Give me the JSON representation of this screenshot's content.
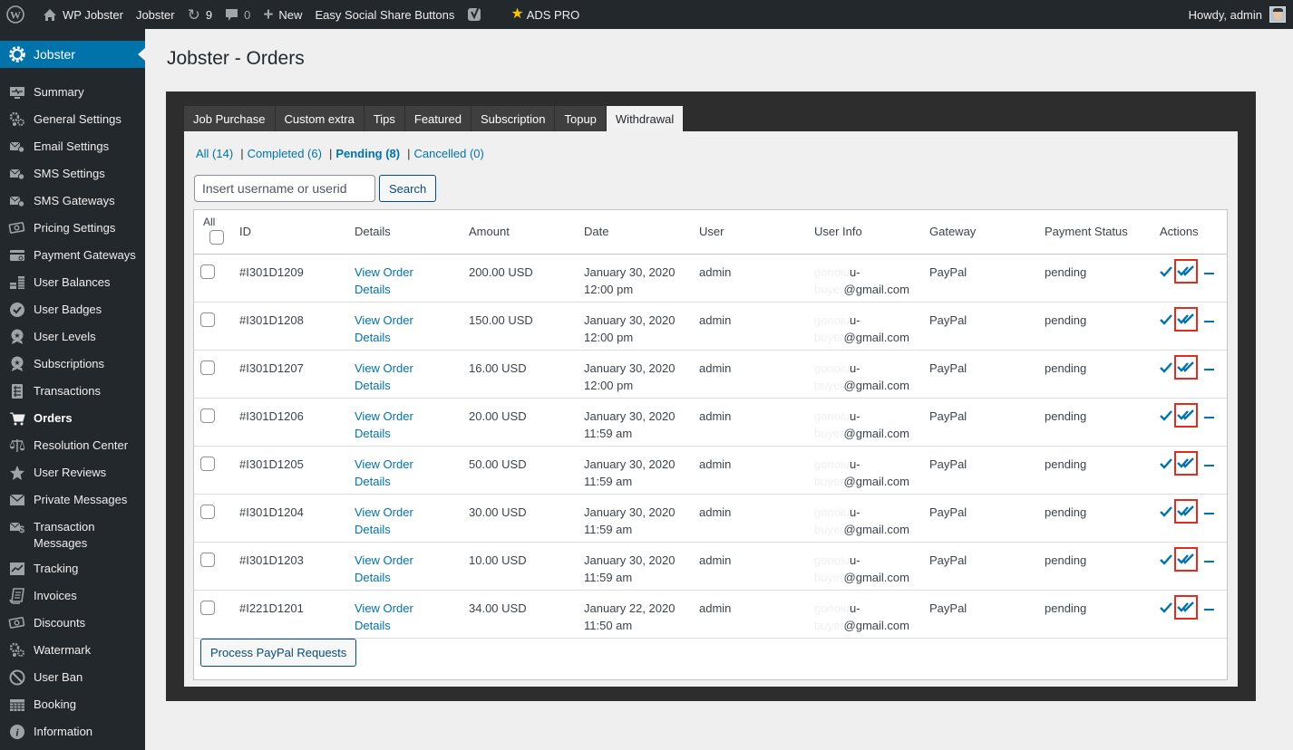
{
  "admin_bar": {
    "site_name": "WP Jobster",
    "plugin_menu": "Jobster",
    "updates_count": "9",
    "comments_count": "0",
    "new_label": "New",
    "essb_label": "Easy Social Share Buttons",
    "ads_label": "ADS PRO",
    "greeting": "Howdy, admin"
  },
  "sidebar": {
    "header": "Jobster",
    "items": [
      {
        "label": "Summary",
        "icon": "pulse-monitor-icon"
      },
      {
        "label": "General Settings",
        "icon": "gears-icon"
      },
      {
        "label": "Email Settings",
        "icon": "mail-gear-icon"
      },
      {
        "label": "SMS Settings",
        "icon": "mail-gear-icon"
      },
      {
        "label": "SMS Gateways",
        "icon": "mail-gear-icon"
      },
      {
        "label": "Pricing Settings",
        "icon": "money-icon"
      },
      {
        "label": "Payment Gateways",
        "icon": "card-icon"
      },
      {
        "label": "User Balances",
        "icon": "coins-icon"
      },
      {
        "label": "User Badges",
        "icon": "badge-check-icon"
      },
      {
        "label": "User Levels",
        "icon": "award-icon"
      },
      {
        "label": "Subscriptions",
        "icon": "award-icon"
      },
      {
        "label": "Transactions",
        "icon": "list-icon"
      },
      {
        "label": "Orders",
        "icon": "cart-icon",
        "active": true
      },
      {
        "label": "Resolution Center",
        "icon": "scales-icon"
      },
      {
        "label": "User Reviews",
        "icon": "star-icon"
      },
      {
        "label": "Private Messages",
        "icon": "envelope-icon"
      },
      {
        "label": "Transaction Messages",
        "icon": "mail-dollar-icon"
      },
      {
        "label": "Tracking",
        "icon": "chart-line-icon"
      },
      {
        "label": "Invoices",
        "icon": "receipt-icon"
      },
      {
        "label": "Discounts",
        "icon": "money-icon"
      },
      {
        "label": "Watermark",
        "icon": "gears-icon"
      },
      {
        "label": "User Ban",
        "icon": "ban-icon"
      },
      {
        "label": "Booking",
        "icon": "calendar-icon"
      },
      {
        "label": "Information",
        "icon": "info-icon"
      }
    ]
  },
  "page": {
    "title": "Jobster - Orders",
    "tabs": [
      "Job Purchase",
      "Custom extra",
      "Tips",
      "Featured",
      "Subscription",
      "Topup",
      "Withdrawal"
    ],
    "active_tab": "Withdrawal",
    "filters": [
      {
        "label": "All (14)",
        "current": false
      },
      {
        "label": "Completed (6)",
        "current": false
      },
      {
        "label": "Pending (8)",
        "current": true
      },
      {
        "label": "Cancelled (0)",
        "current": false
      }
    ],
    "search": {
      "placeholder": "Insert username or userid",
      "value": "",
      "button": "Search"
    },
    "table": {
      "all_label": "All",
      "columns": [
        "ID",
        "Details",
        "Amount",
        "Date",
        "User",
        "User Info",
        "Gateway",
        "Payment Status",
        "Actions"
      ],
      "rows": [
        {
          "id": "#I301D1209",
          "details_1": "View Order",
          "details_2": "Details",
          "amount": "200.00 USD",
          "date": "January 30, 2020",
          "time": "12:00 pm",
          "user": "admin",
          "info_hidden_1": "gonoiu",
          "info_1": "u-",
          "info_hidden_2": "buyer",
          "info_2": "@gmail.com",
          "gateway": "PayPal",
          "status": "pending"
        },
        {
          "id": "#I301D1208",
          "details_1": "View Order",
          "details_2": "Details",
          "amount": "150.00 USD",
          "date": "January 30, 2020",
          "time": "12:00 pm",
          "user": "admin",
          "info_hidden_1": "gonoiu",
          "info_1": "u-",
          "info_hidden_2": "buyer",
          "info_2": "@gmail.com",
          "gateway": "PayPal",
          "status": "pending"
        },
        {
          "id": "#I301D1207",
          "details_1": "View Order",
          "details_2": "Details",
          "amount": "16.00 USD",
          "date": "January 30, 2020",
          "time": "12:00 pm",
          "user": "admin",
          "info_hidden_1": "gonoiu",
          "info_1": "u-",
          "info_hidden_2": "buyer",
          "info_2": "@gmail.com",
          "gateway": "PayPal",
          "status": "pending"
        },
        {
          "id": "#I301D1206",
          "details_1": "View Order",
          "details_2": "Details",
          "amount": "20.00 USD",
          "date": "January 30, 2020",
          "time": "11:59 am",
          "user": "admin",
          "info_hidden_1": "gonoiu",
          "info_1": "u-",
          "info_hidden_2": "buyer",
          "info_2": "@gmail.com",
          "gateway": "PayPal",
          "status": "pending"
        },
        {
          "id": "#I301D1205",
          "details_1": "View Order",
          "details_2": "Details",
          "amount": "50.00 USD",
          "date": "January 30, 2020",
          "time": "11:59 am",
          "user": "admin",
          "info_hidden_1": "gonoiu",
          "info_1": "u-",
          "info_hidden_2": "buyer",
          "info_2": "@gmail.com",
          "gateway": "PayPal",
          "status": "pending"
        },
        {
          "id": "#I301D1204",
          "details_1": "View Order",
          "details_2": "Details",
          "amount": "30.00 USD",
          "date": "January 30, 2020",
          "time": "11:59 am",
          "user": "admin",
          "info_hidden_1": "gonoiu",
          "info_1": "u-",
          "info_hidden_2": "buyer",
          "info_2": "@gmail.com",
          "gateway": "PayPal",
          "status": "pending"
        },
        {
          "id": "#I301D1203",
          "details_1": "View Order",
          "details_2": "Details",
          "amount": "10.00 USD",
          "date": "January 30, 2020",
          "time": "11:59 am",
          "user": "admin",
          "info_hidden_1": "gonoiu",
          "info_1": "u-",
          "info_hidden_2": "buyer",
          "info_2": "@gmail.com",
          "gateway": "PayPal",
          "status": "pending"
        },
        {
          "id": "#I221D1201",
          "details_1": "View Order",
          "details_2": "Details",
          "amount": "34.00 USD",
          "date": "January 22, 2020",
          "time": "11:50 am",
          "user": "admin",
          "info_hidden_1": "gonoiu",
          "info_1": "u-",
          "info_hidden_2": "buyer",
          "info_2": "@gmail.com",
          "gateway": "PayPal",
          "status": "pending"
        }
      ]
    },
    "process_button": "Process PayPal Requests"
  },
  "colors": {
    "accent": "#0073aa",
    "admin_bar": "#23282d",
    "highlight_box": "#e12d1f"
  }
}
